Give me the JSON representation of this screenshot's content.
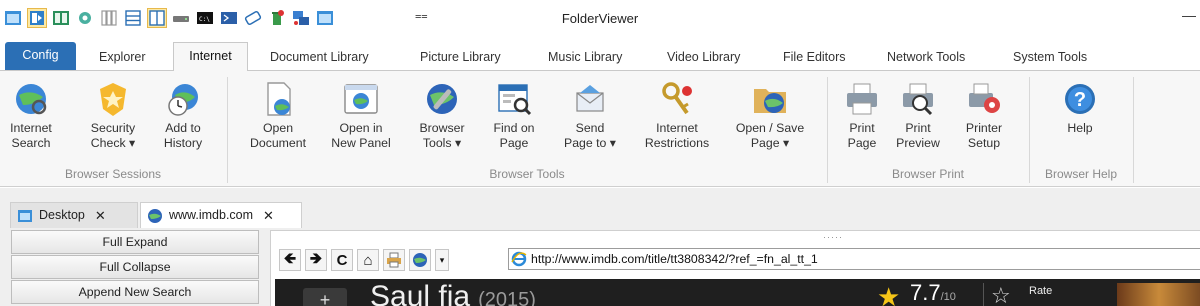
{
  "app": {
    "title": "FolderViewer"
  },
  "qat": {
    "dropdown": "⩵",
    "minimize": "—"
  },
  "tabs": [
    "Config",
    "Explorer",
    "Internet",
    "Document Library",
    "Picture Library",
    "Music Library",
    "Video Library",
    "File Editors",
    "Network Tools",
    "System Tools"
  ],
  "ribbon": {
    "groups": {
      "browser_sessions": "Browser Sessions",
      "browser_tools": "Browser Tools",
      "browser_print": "Browser Print",
      "browser_help": "Browser Help"
    },
    "buttons": {
      "internet_search": [
        "Internet",
        "Search"
      ],
      "security_check": [
        "Security",
        "Check ▾"
      ],
      "add_to_history": [
        "Add to",
        "History"
      ],
      "open_document": [
        "Open",
        "Document"
      ],
      "open_new_panel": [
        "Open in",
        "New Panel"
      ],
      "browser_tools": [
        "Browser",
        "Tools ▾"
      ],
      "find_on_page": [
        "Find on",
        "Page"
      ],
      "send_page": [
        "Send",
        "Page to ▾"
      ],
      "internet_restrictions": [
        "Internet",
        "Restrictions"
      ],
      "open_save_page": [
        "Open / Save",
        "Page ▾"
      ],
      "print_page": [
        "Print",
        "Page"
      ],
      "print_preview": [
        "Print",
        "Preview"
      ],
      "printer_setup": [
        "Printer",
        "Setup"
      ],
      "help": [
        "Help",
        ""
      ]
    }
  },
  "doc_tabs": [
    {
      "label": "Desktop",
      "close": "✕"
    },
    {
      "label": "www.imdb.com",
      "close": "✕"
    }
  ],
  "left_panel": {
    "buttons": [
      "Full Expand",
      "Full Collapse",
      "Append New Search"
    ]
  },
  "browser": {
    "grip": "·····",
    "nav": {
      "back": "🡸",
      "forward": "🡺",
      "refresh": "C",
      "home": "⌂",
      "dropdown": "▾"
    },
    "url": "http://www.imdb.com/title/tt3808342/?ref_=fn_al_tt_1",
    "page": {
      "plus": "+",
      "title": "Saul fia",
      "year": "(2015)",
      "rating": "7.7",
      "rating_suffix": "/10",
      "rate_label": "Rate"
    }
  },
  "colors": {
    "accent": "#2b6fb5",
    "imdb_star": "#f5c518"
  }
}
